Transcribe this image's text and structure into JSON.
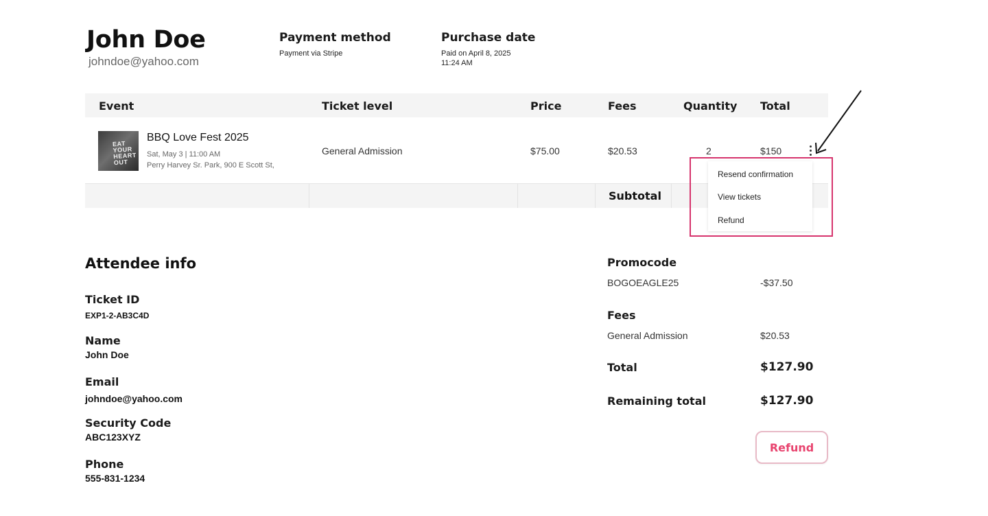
{
  "customer": {
    "name": "John Doe",
    "email": "johndoe@yahoo.com"
  },
  "payment": {
    "title": "Payment method",
    "value": "Payment via Stripe"
  },
  "purchase": {
    "title": "Purchase date",
    "line1": "Paid on April 8, 2025",
    "line2": "11:24 AM"
  },
  "table": {
    "headers": {
      "event": "Event",
      "ticket_level": "Ticket level",
      "price": "Price",
      "fees": "Fees",
      "quantity": "Quantity",
      "total": "Total"
    },
    "row": {
      "thumb_text": "EAT YOUR HEART OUT",
      "event_name": "BBQ Love Fest 2025",
      "event_date": "Sat, May 3 | 11:00 AM",
      "event_location": "Perry Harvey Sr. Park, 900 E Scott St,",
      "ticket_level": "General Admission",
      "price": "$75.00",
      "fees": "$20.53",
      "quantity": "2",
      "total": "$150"
    },
    "subtotal_label": "Subtotal"
  },
  "menu": {
    "items": [
      "Resend confirmation",
      "View tickets",
      "Refund"
    ]
  },
  "attendee": {
    "title": "Attendee info",
    "ticket_id_label": "Ticket ID",
    "ticket_id": "EXP1-2-AB3C4D",
    "name_label": "Name",
    "name": "John Doe",
    "email_label": "Email",
    "email": "johndoe@yahoo.com",
    "security_label": "Security Code",
    "security": "ABC123XYZ",
    "phone_label": "Phone",
    "phone": "555-831-1234"
  },
  "summary": {
    "promo_title": "Promocode",
    "promo_code": "BOGOEAGLE25",
    "promo_amount": "-$37.50",
    "fees_title": "Fees",
    "fees_item": "General Admission",
    "fees_amount": "$20.53",
    "total_label": "Total",
    "total": "$127.90",
    "remaining_label": "Remaining total",
    "remaining": "$127.90"
  },
  "refund_button": "Refund",
  "colors": {
    "accent": "#e8446f",
    "highlight": "#d6336c",
    "header_bg": "#f4f4f4"
  },
  "icons": {
    "more": "more-vertical-icon",
    "arrow": "arrow-annotation-icon"
  }
}
